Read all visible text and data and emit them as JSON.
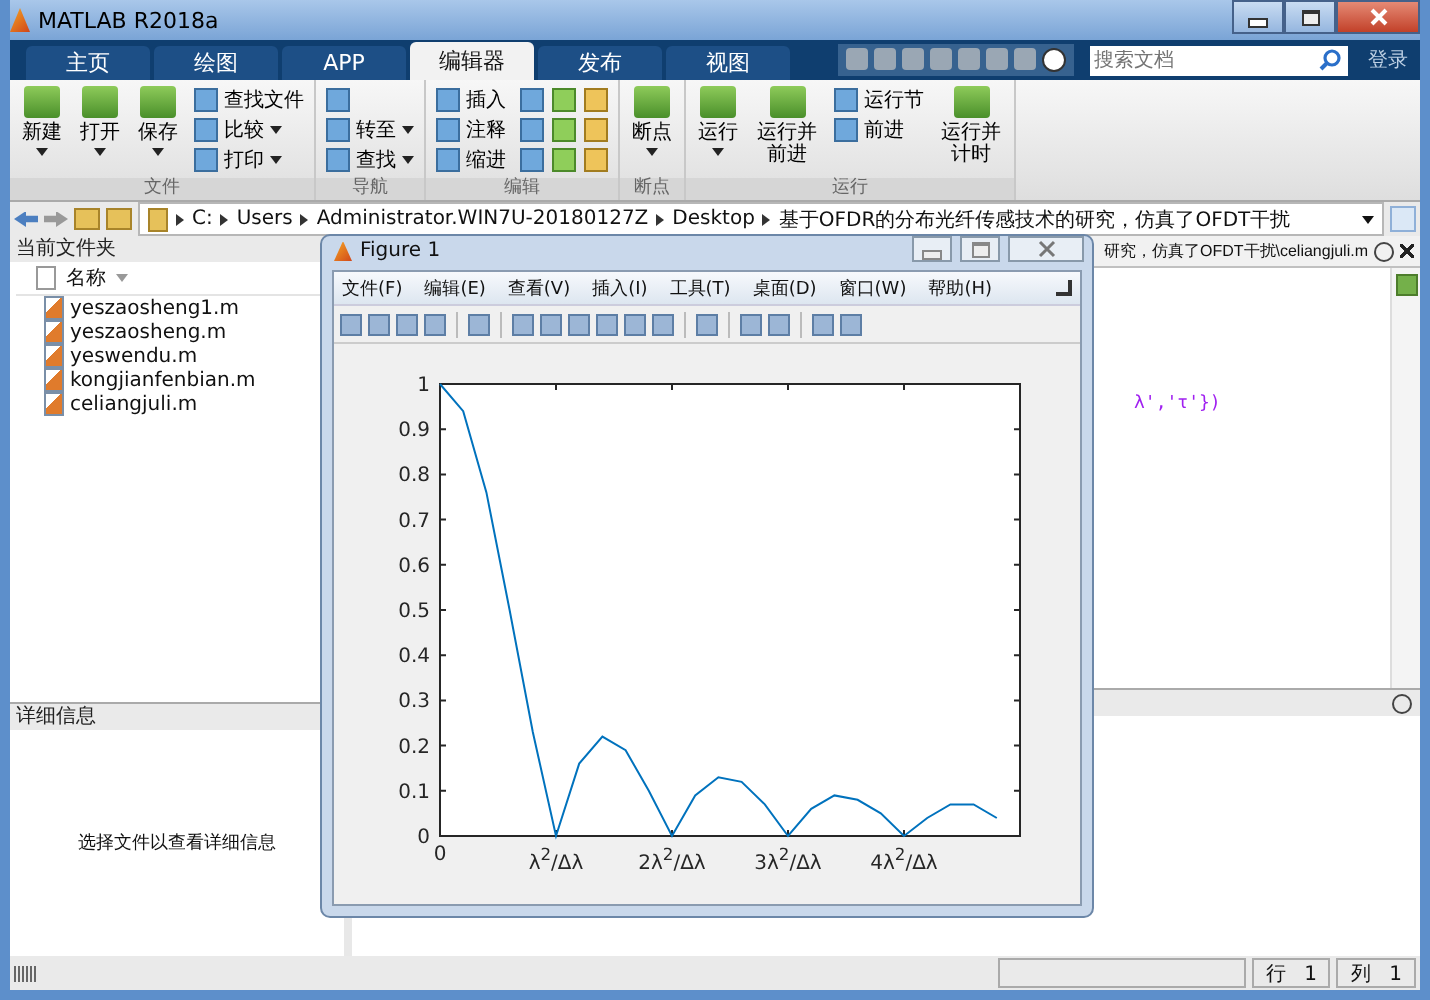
{
  "window": {
    "title": "MATLAB R2018a"
  },
  "tabs": [
    {
      "label": "主页",
      "selected": false
    },
    {
      "label": "绘图",
      "selected": false
    },
    {
      "label": "APP",
      "selected": false
    },
    {
      "label": "编辑器",
      "selected": true
    },
    {
      "label": "发布",
      "selected": false
    },
    {
      "label": "视图",
      "selected": false
    }
  ],
  "search": {
    "placeholder": "搜索文档"
  },
  "login": "登录",
  "ribbon": [
    {
      "label": "文件",
      "columns": [
        {
          "kind": "large",
          "items": [
            {
              "label": "新建",
              "dropdown": true
            }
          ]
        },
        {
          "kind": "large",
          "items": [
            {
              "label": "打开",
              "dropdown": true
            }
          ]
        },
        {
          "kind": "large",
          "items": [
            {
              "label": "保存",
              "dropdown": true
            }
          ]
        },
        {
          "kind": "small",
          "items": [
            {
              "label": "查找文件",
              "dropdown": false
            },
            {
              "label": "比较",
              "dropdown": true
            },
            {
              "label": "打印",
              "dropdown": true
            }
          ]
        }
      ]
    },
    {
      "label": "导航",
      "columns": [
        {
          "kind": "small",
          "items": [
            {
              "dropdown": false
            },
            {
              "label": "转至",
              "dropdown": true
            },
            {
              "label": "查找",
              "dropdown": true
            }
          ]
        }
      ]
    },
    {
      "label": "编辑",
      "columns": [
        {
          "kind": "small",
          "items": [
            {
              "label": "插入",
              "dropdown": false
            },
            {
              "label": "注释",
              "dropdown": false
            },
            {
              "label": "缩进",
              "dropdown": false
            }
          ]
        },
        {
          "kind": "icons"
        }
      ]
    },
    {
      "label": "断点",
      "columns": [
        {
          "kind": "large",
          "items": [
            {
              "label": "断点",
              "dropdown": true
            }
          ]
        }
      ]
    },
    {
      "label": "运行",
      "columns": [
        {
          "kind": "large",
          "items": [
            {
              "label": "运行",
              "dropdown": true
            }
          ]
        },
        {
          "kind": "large",
          "items": [
            {
              "label": "运行并前进",
              "dropdown": false
            }
          ]
        },
        {
          "kind": "small",
          "items": [
            {
              "label": "运行节",
              "dropdown": false
            },
            {
              "label": "前进",
              "dropdown": false
            }
          ]
        },
        {
          "kind": "large",
          "items": [
            {
              "label": "运行并计时",
              "dropdown": false
            }
          ]
        }
      ]
    }
  ],
  "address": {
    "path": [
      "C:",
      "Users",
      "Administrator.WIN7U-20180127Z",
      "Desktop",
      "基于OFDR的分布光纤传感技术的研究，仿真了OFDT干扰"
    ]
  },
  "current_folder": {
    "title": "当前文件夹",
    "column": "名称",
    "files": [
      "yeszaosheng1.m",
      "yeszaosheng.m",
      "yeswendu.m",
      "kongjianfenbian.m",
      "celiangjuli.m"
    ]
  },
  "details": {
    "title": "详细信息",
    "message": "选择文件以查看详细信息"
  },
  "editor": {
    "tab": "研究，仿真了OFDT干扰\\celiangjuli.m",
    "code_fragment": "λ','τ'})"
  },
  "figure": {
    "title": "Figure 1",
    "menus": [
      "文件(F)",
      "编辑(E)",
      "查看(V)",
      "插入(I)",
      "工具(T)",
      "桌面(D)",
      "窗口(W)",
      "帮助(H)"
    ],
    "chart_data": {
      "type": "line",
      "categories": [
        "0",
        null,
        null,
        null,
        null,
        "λ$^{2}$/Δλ",
        null,
        null,
        null,
        null,
        "2λ$^{2}$/Δλ",
        null,
        null,
        null,
        null,
        "3λ$^{2}$/Δλ",
        null,
        null,
        null,
        null,
        "4λ$^{2}$/Δλ",
        null,
        null,
        null,
        null
      ],
      "series": [
        {
          "color": "#0072bd",
          "values": [
            1,
            0.94,
            0.76,
            0.5,
            0.23,
            0,
            0.16,
            0.22,
            0.19,
            0.1,
            0,
            0.09,
            0.13,
            0.12,
            0.07,
            0,
            0.06,
            0.09,
            0.08,
            0.05,
            0,
            0.04,
            0.07,
            0.07,
            0.04
          ]
        }
      ],
      "ylim": [
        0,
        1
      ],
      "yticks": [
        0,
        0.1,
        0.2,
        0.3,
        0.4,
        0.5,
        0.6,
        0.7,
        0.8,
        0.9,
        1
      ]
    }
  },
  "status_bar": {
    "row": "行 1",
    "col": "列 1"
  }
}
